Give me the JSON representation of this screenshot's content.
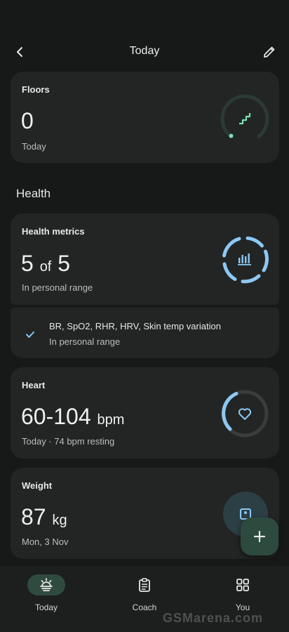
{
  "header": {
    "title": "Today"
  },
  "floors": {
    "title": "Floors",
    "value": "0",
    "caption": "Today"
  },
  "section": {
    "health": "Health"
  },
  "health_metrics": {
    "title": "Health metrics",
    "count": "5",
    "of": "of",
    "total": "5",
    "caption": "In personal range",
    "detail_line1": "BR, SpO2, RHR, HRV, Skin temp variation",
    "detail_line2": "In personal range"
  },
  "heart": {
    "title": "Heart",
    "range": "60-104",
    "unit": "bpm",
    "caption": "Today · 74 bpm resting"
  },
  "weight": {
    "title": "Weight",
    "value": "87",
    "unit": "kg",
    "caption": "Mon, 3 Nov"
  },
  "nav": {
    "today": "Today",
    "coach": "Coach",
    "you": "You"
  },
  "watermark": "GSMarena.com",
  "colors": {
    "accent_green": "#7be0b4",
    "accent_blue": "#8cc8f5",
    "fab_bg": "#2d4a3f"
  },
  "icons": [
    "back-arrow-icon",
    "pencil-icon",
    "stairs-icon",
    "bar-chart-icon",
    "checkmark-icon",
    "heart-icon",
    "scale-icon",
    "plus-icon",
    "sun-icon",
    "clipboard-icon",
    "grid-icon"
  ]
}
